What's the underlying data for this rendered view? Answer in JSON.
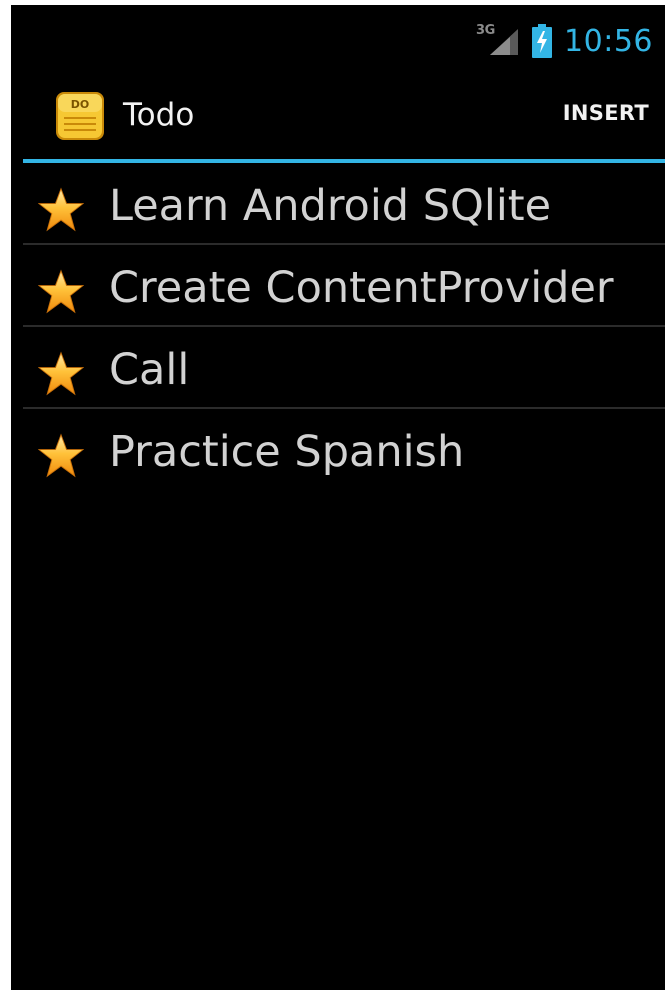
{
  "status_bar": {
    "network_type": "3G",
    "time": "10:56",
    "icons": [
      "signal-icon",
      "battery-charging-icon"
    ]
  },
  "action_bar": {
    "app_icon": "notepad-icon",
    "app_icon_text": "DO",
    "title": "Todo",
    "insert_label": "INSERT",
    "accent_color": "#33b5e5"
  },
  "todos": [
    {
      "icon": "star-icon",
      "label": "Learn Android SQlite"
    },
    {
      "icon": "star-icon",
      "label": "Create ContentProvider"
    },
    {
      "icon": "star-icon",
      "label": "Call"
    },
    {
      "icon": "star-icon",
      "label": "Practice Spanish"
    }
  ],
  "colors": {
    "background": "#000000",
    "accent": "#33b5e5",
    "star": "#f7a81b",
    "text": "#d2d2d2"
  }
}
